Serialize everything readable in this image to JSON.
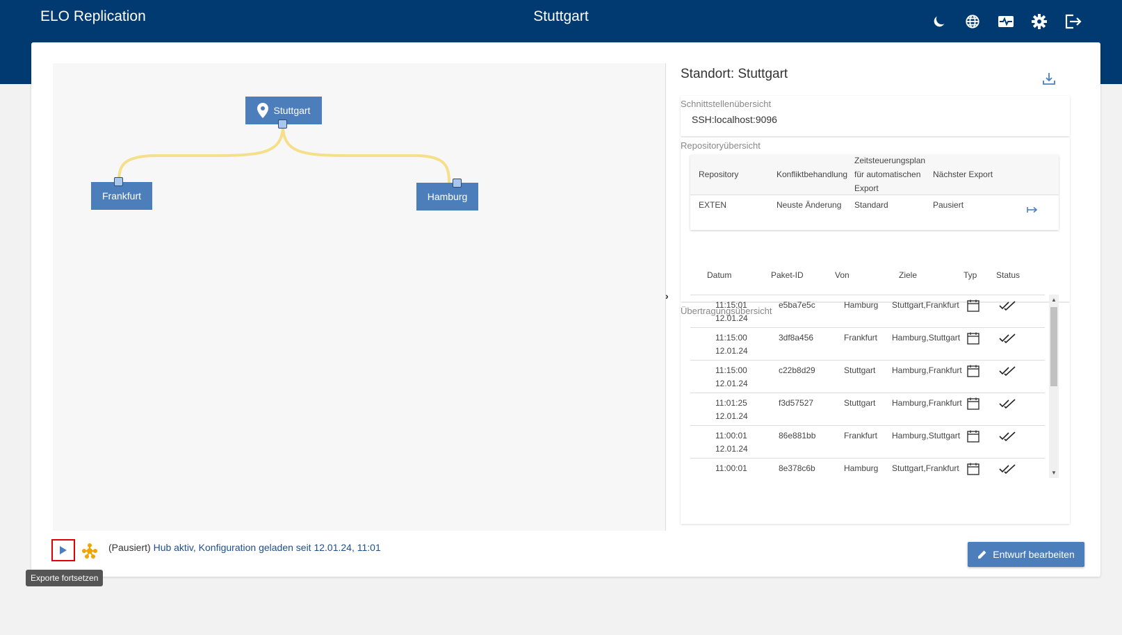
{
  "header": {
    "app_title": "ELO Replication",
    "location_title": "Stuttgart"
  },
  "top_icons": [
    "moon-icon",
    "globe-icon",
    "monitor-icon",
    "gear-icon",
    "logout-icon"
  ],
  "graph": {
    "nodes": {
      "hub": "Stuttgart",
      "left": "Frankfurt",
      "right": "Hamburg"
    },
    "edge_color": "#f6df8a",
    "node_color": "#4d7ebc"
  },
  "panel": {
    "title": "Standort: Stuttgart",
    "interfaces_label": "Schnittstellenübersicht",
    "interface_value": "SSH:localhost:9096",
    "repo_label": "Repositoryübersicht",
    "repo_headers": [
      "Repository",
      "Konfliktbehandlung",
      "Zeitsteuerungsplan für automatischen Export",
      "Nächster Export"
    ],
    "repo_row": [
      "EXTEN",
      "Neuste Änderung",
      "Standard",
      "Pausiert"
    ],
    "tx_label": "Übertragungsübersicht",
    "tx_headers": [
      "Datum",
      "Paket-ID",
      "Von",
      "Ziele",
      "Typ",
      "Status"
    ],
    "tx_rows": [
      {
        "time": "11:15:01",
        "date": "12.01.24",
        "id": "e5ba7e5c",
        "from": "Hamburg",
        "to": "Stuttgart,Frankfurt"
      },
      {
        "time": "11:15:00",
        "date": "12.01.24",
        "id": "3df8a456",
        "from": "Frankfurt",
        "to": "Hamburg,Stuttgart"
      },
      {
        "time": "11:15:00",
        "date": "12.01.24",
        "id": "c22b8d29",
        "from": "Stuttgart",
        "to": "Hamburg,Frankfurt"
      },
      {
        "time": "11:01:25",
        "date": "12.01.24",
        "id": "f3d57527",
        "from": "Stuttgart",
        "to": "Hamburg,Frankfurt"
      },
      {
        "time": "11:00:01",
        "date": "12.01.24",
        "id": "86e881bb",
        "from": "Frankfurt",
        "to": "Hamburg,Stuttgart"
      },
      {
        "time": "11:00:01",
        "date": "",
        "id": "8e378c6b",
        "from": "Hamburg",
        "to": "Stuttgart,Frankfurt"
      }
    ]
  },
  "status_bar": {
    "paused": "(Pausiert)",
    "text": "Hub aktiv, Konfiguration geladen seit 12.01.24, ",
    "time": "11:01",
    "tooltip": "Exporte fortsetzen",
    "edit_button": "Entwurf bearbeiten"
  }
}
